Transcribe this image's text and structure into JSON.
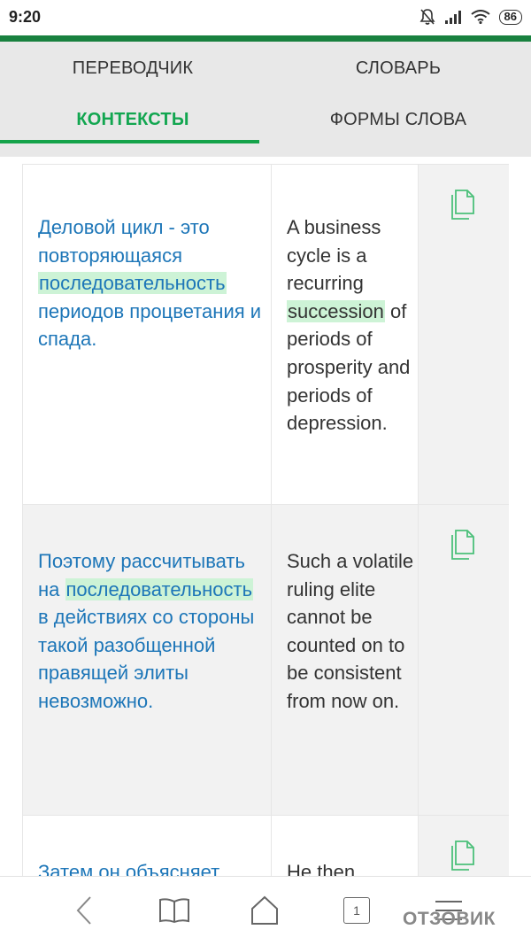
{
  "status_bar": {
    "time": "9:20",
    "battery": "86",
    "icons": [
      "mute-icon",
      "signal-icon",
      "wifi-icon",
      "battery-icon"
    ]
  },
  "colors": {
    "accent_green": "#15a34a",
    "header_green": "#19813f",
    "link_blue": "#1d76b8",
    "highlight": "#cdf3d6"
  },
  "tabs": {
    "translator": "ПЕРЕВОДЧИК",
    "dictionary": "СЛОВАРЬ",
    "contexts": "КОНТЕКСТЫ",
    "word_forms": "ФОРМЫ СЛОВА",
    "active": "КОНТЕКСТЫ"
  },
  "examples": [
    {
      "ru_before": "Деловой цикл - это повторяющаяся ",
      "ru_highlight": "последовательность",
      "ru_after": " периодов процветания и спада.",
      "en_before": "A business cycle is a recurring ",
      "en_highlight": "succession",
      "en_after": " of periods of prosperity and periods of depression."
    },
    {
      "ru_before": "Поэтому рассчитывать на ",
      "ru_highlight": "последовательность",
      "ru_after": " в действиях со стороны такой разобщенной правящей элиты невозможно.",
      "en_before": "Such a volatile ruling elite cannot be counted on to be consistent from now on.",
      "en_highlight": "",
      "en_after": ""
    },
    {
      "ru_before": "Затем он объясняет",
      "ru_highlight": "",
      "ru_after": "",
      "en_before": "He then",
      "en_highlight": "",
      "en_after": ""
    }
  ],
  "bottom_nav": {
    "tab_count": "1",
    "watermark": "ОТЗОВИК"
  }
}
